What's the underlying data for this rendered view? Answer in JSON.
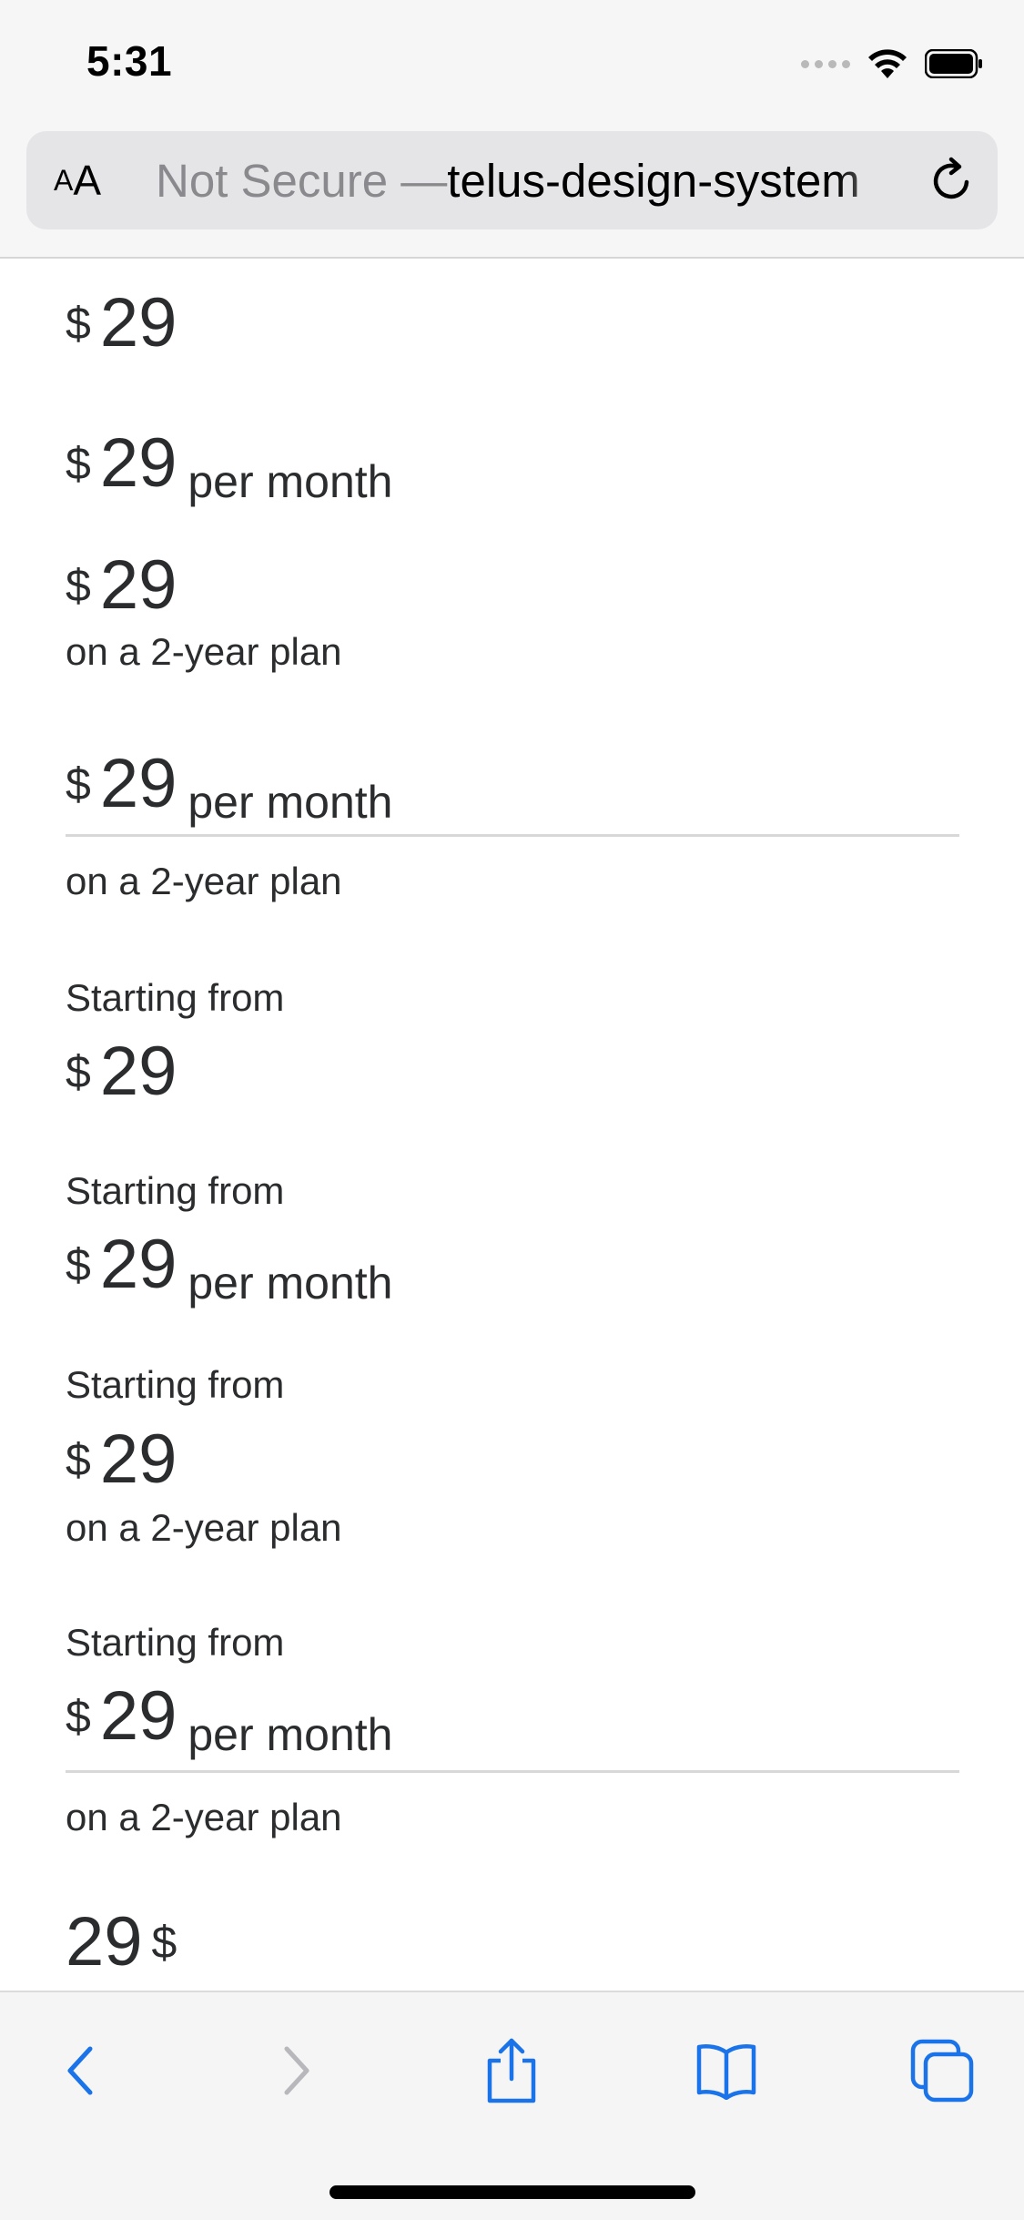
{
  "status_bar": {
    "time": "5:31"
  },
  "address_bar": {
    "aa_small": "A",
    "aa_large": "A",
    "url_prefix": "Not Secure — ",
    "url_host": "telus-design-system"
  },
  "prices": {
    "currency": "$",
    "amount": "29",
    "rate_period": "per month",
    "rate_text": "on a 2-year plan",
    "prefix": "Starting from"
  },
  "toolbar": {
    "icons": [
      "back-icon",
      "forward-icon",
      "share-icon",
      "bookmarks-icon",
      "tabs-icon"
    ]
  }
}
